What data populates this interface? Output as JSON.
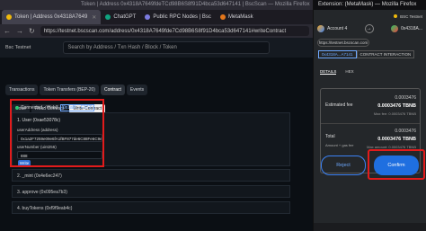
{
  "browser": {
    "window_title": "Token | Address 0x4318A7649fdeTCd98B6S8f91D4bca53d647141 | BscScan — Mozilla Firefox",
    "tabs": [
      {
        "label": "Token | Address 0x4318A7649",
        "icon": "bscscan-icon",
        "active": true
      },
      {
        "label": "ChatGPT",
        "icon": "chatgpt-icon",
        "active": false
      },
      {
        "label": "Public RPC Nodes | Bsc",
        "icon": "rpc-icon",
        "active": false
      },
      {
        "label": "MetaMask",
        "icon": "metamask-icon",
        "active": false
      }
    ],
    "url": "https://testnet.bscscan.com/address/0x4318A7649fde7Cd98B6S8f91D4bca53d647141#writeContract"
  },
  "bscscan": {
    "network": "Bsc Testnet",
    "search_placeholder": "Search by Address / Txn Hash / Block / Token",
    "contract_tabs": [
      "Transactions",
      "Token Transfers (BEP-20)",
      "Contract",
      "Events"
    ],
    "active_contract_tab": "Contract",
    "sub_tabs": [
      "Code",
      "Read Contract",
      "Write Contract"
    ],
    "active_sub_tab": "Write Contract",
    "connected_label": "Connected - Web3",
    "connected_address": "[0x1aB....F372]",
    "function": {
      "title": "1. User (0xae53078c)",
      "field1_label": "userAddress (address)",
      "field1_value": "0x1a2F7259e09e6fA1fBF877de6C88Fe6C9e1F372",
      "field2_label": "userNumber (uint256)",
      "field2_value": "888",
      "write_label": "Write"
    },
    "other_functions": [
      "2. _mint (0x4e6ec247)",
      "3. approve (0x095ea7b3)",
      "4. buyTokens (0xf9f9eab4c)"
    ]
  },
  "extension": {
    "window_title": "Extension: (MetaMask) — Mozilla Firefox",
    "network": "BSC Testnet",
    "account_name": "Account 4",
    "to_address": "0x4318A...",
    "origin": "https://testnet.bscscan.com",
    "to_address_short": "0x4318A...A7141",
    "interaction_label": "CONTRACT INTERACTION",
    "tabs": [
      "DETAILS",
      "HEX"
    ],
    "estimated_fee_label": "Estimated fee",
    "estimated_fee_value": "0.0003476",
    "estimated_fee_bold": "0.0003476 TBNB",
    "max_fee_label": "Max fee:",
    "max_fee_value": "0.0003476 TBNB",
    "total_label": "Total",
    "total_value": "0.0003476",
    "total_bold": "0.0003476 TBNB",
    "amount_gas_label": "Amount + gas fee",
    "max_amount_label": "Max amount:",
    "max_amount_value": "0.0003476 TBNB",
    "reject_label": "Reject",
    "confirm_label": "Confirm"
  },
  "colors": {
    "highlight": "#e21b1b",
    "link": "#6ea8fe",
    "confirm": "#1f6fe0",
    "connected": "#29c76f"
  }
}
